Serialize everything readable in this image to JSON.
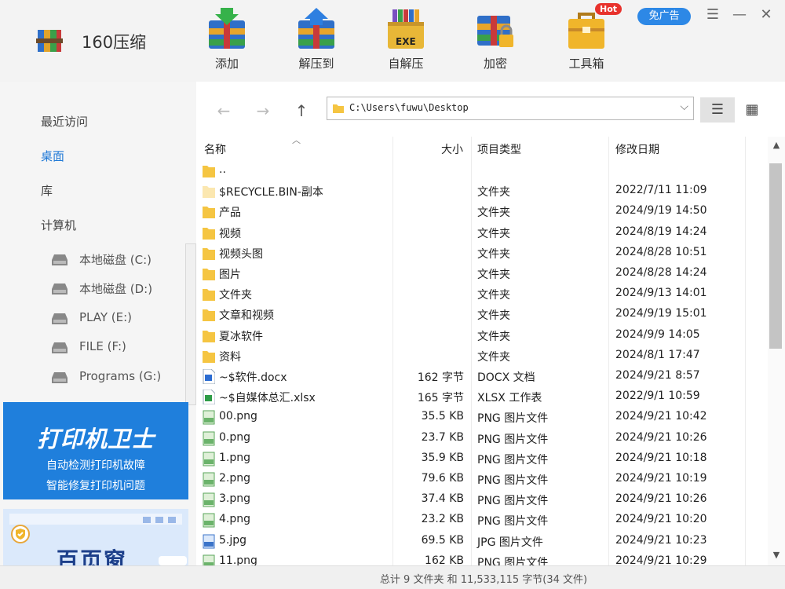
{
  "app": {
    "name": "160压缩",
    "hot_badge": "Hot",
    "noads_label": "免广告"
  },
  "toolbar": [
    {
      "label": "添加",
      "icon": "add-archive-icon"
    },
    {
      "label": "解压到",
      "icon": "extract-to-icon"
    },
    {
      "label": "自解压",
      "icon": "self-extract-exe-icon",
      "icon_text": "EXE"
    },
    {
      "label": "加密",
      "icon": "encrypt-lock-icon"
    },
    {
      "label": "工具箱",
      "icon": "toolbox-icon"
    }
  ],
  "window": {
    "menu": "☰",
    "minimize": "—",
    "close": "✕"
  },
  "sidebar": {
    "nav": [
      {
        "label": "最近访问",
        "active": false
      },
      {
        "label": "桌面",
        "active": true
      },
      {
        "label": "库",
        "active": false
      },
      {
        "label": "计算机",
        "active": false
      }
    ],
    "drives": [
      "本地磁盘 (C:)",
      "本地磁盘 (D:)",
      "PLAY (E:)",
      "FILE (F:)",
      "Programs (G:)"
    ],
    "ad1": {
      "title": "打印机卫士",
      "line1": "自动检测打印机故障",
      "line2": "智能修复打印机问题"
    },
    "ad2": {
      "title": "百页窗"
    }
  },
  "navbar": {
    "path": "C:\\Users\\fuwu\\Desktop",
    "back": "←",
    "forward": "→",
    "up": "↑"
  },
  "columns": {
    "name": "名称",
    "size": "大小",
    "type": "项目类型",
    "date": "修改日期"
  },
  "files": [
    {
      "name": "..",
      "size": "",
      "type": "",
      "date": "",
      "icon": "folder"
    },
    {
      "name": "$RECYCLE.BIN-副本",
      "size": "",
      "type": "文件夹",
      "date": "2022/7/11 11:09",
      "icon": "folder-pale"
    },
    {
      "name": "产品",
      "size": "",
      "type": "文件夹",
      "date": "2024/9/19 14:50",
      "icon": "folder"
    },
    {
      "name": "视频",
      "size": "",
      "type": "文件夹",
      "date": "2024/8/19 14:24",
      "icon": "folder"
    },
    {
      "name": "视频头图",
      "size": "",
      "type": "文件夹",
      "date": "2024/8/28 10:51",
      "icon": "folder"
    },
    {
      "name": "图片",
      "size": "",
      "type": "文件夹",
      "date": "2024/8/28 14:24",
      "icon": "folder"
    },
    {
      "name": "文件夹",
      "size": "",
      "type": "文件夹",
      "date": "2024/9/13 14:01",
      "icon": "folder"
    },
    {
      "name": "文章和视频",
      "size": "",
      "type": "文件夹",
      "date": "2024/9/19 15:01",
      "icon": "folder"
    },
    {
      "name": "夏冰软件",
      "size": "",
      "type": "文件夹",
      "date": "2024/9/9 14:05",
      "icon": "folder"
    },
    {
      "name": "资料",
      "size": "",
      "type": "文件夹",
      "date": "2024/8/1 17:47",
      "icon": "folder"
    },
    {
      "name": "~$软件.docx",
      "size": "162 字节",
      "type": "DOCX 文档",
      "date": "2024/9/21 8:57",
      "icon": "docx"
    },
    {
      "name": "~$自媒体总汇.xlsx",
      "size": "165 字节",
      "type": "XLSX 工作表",
      "date": "2022/9/1 10:59",
      "icon": "xlsx"
    },
    {
      "name": "00.png",
      "size": "35.5 KB",
      "type": "PNG 图片文件",
      "date": "2024/9/21 10:42",
      "icon": "png"
    },
    {
      "name": "0.png",
      "size": "23.7 KB",
      "type": "PNG 图片文件",
      "date": "2024/9/21 10:26",
      "icon": "png"
    },
    {
      "name": "1.png",
      "size": "35.9 KB",
      "type": "PNG 图片文件",
      "date": "2024/9/21 10:18",
      "icon": "png"
    },
    {
      "name": "2.png",
      "size": "79.6 KB",
      "type": "PNG 图片文件",
      "date": "2024/9/21 10:19",
      "icon": "png"
    },
    {
      "name": "3.png",
      "size": "37.4 KB",
      "type": "PNG 图片文件",
      "date": "2024/9/21 10:26",
      "icon": "png"
    },
    {
      "name": "4.png",
      "size": "23.2 KB",
      "type": "PNG 图片文件",
      "date": "2024/9/21 10:20",
      "icon": "png"
    },
    {
      "name": "5.jpg",
      "size": "69.5 KB",
      "type": "JPG 图片文件",
      "date": "2024/9/21 10:23",
      "icon": "jpg"
    },
    {
      "name": "11.png",
      "size": "162 KB",
      "type": "PNG 图片文件",
      "date": "2024/9/21 10:29",
      "icon": "png"
    }
  ],
  "status": "总计 9 文件夹 和 11,533,115 字节(34 文件)"
}
